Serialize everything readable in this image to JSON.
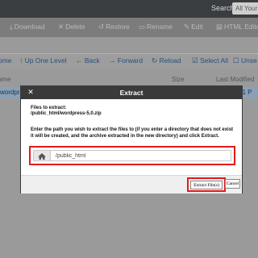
{
  "topbar": {
    "search_label": "Search",
    "search_placeholder": "All Your"
  },
  "toolbar": {
    "items": [
      {
        "icon": "download-icon",
        "label": "Download"
      },
      {
        "icon": "delete-icon",
        "label": "Delete"
      },
      {
        "icon": "restore-icon",
        "label": "Restore"
      },
      {
        "icon": "rename-icon",
        "label": "Rename"
      },
      {
        "icon": "edit-icon",
        "label": "Edit"
      },
      {
        "icon": "html-editor-icon",
        "label": "HTML Editor"
      }
    ]
  },
  "subtoolbar": {
    "items": [
      {
        "label": "ome"
      },
      {
        "icon": "up-arrow-icon",
        "label": "Up One Level"
      },
      {
        "icon": "back-arrow-icon",
        "label": "Back"
      },
      {
        "icon": "forward-arrow-icon",
        "label": "Forward"
      },
      {
        "icon": "reload-icon",
        "label": "Reload"
      },
      {
        "icon": "select-all-icon",
        "label": "Select All"
      },
      {
        "icon": "unselect-icon",
        "label": "Unse"
      }
    ]
  },
  "table": {
    "headers": [
      "ame",
      "Size",
      "Last Modified"
    ],
    "row": {
      "name": "wordpres",
      "modified": "31 P"
    }
  },
  "modal": {
    "title": "Extract",
    "files_label": "Files to extract:",
    "file_path": "/public_html/wordpress-5.0.zip",
    "instructions": "Enter the path you wish to extract the files to (if you enter a directory that does not exist it will be created, and the archive extracted in the new directory) and click Extract.",
    "path_value": "/public_html",
    "extract_label": "Extract File(s)",
    "cancel_label": "Cancel"
  },
  "colors": {
    "highlight": "#e21b1b",
    "modal_header": "#3a3a3a",
    "link": "#2b4f7a"
  }
}
